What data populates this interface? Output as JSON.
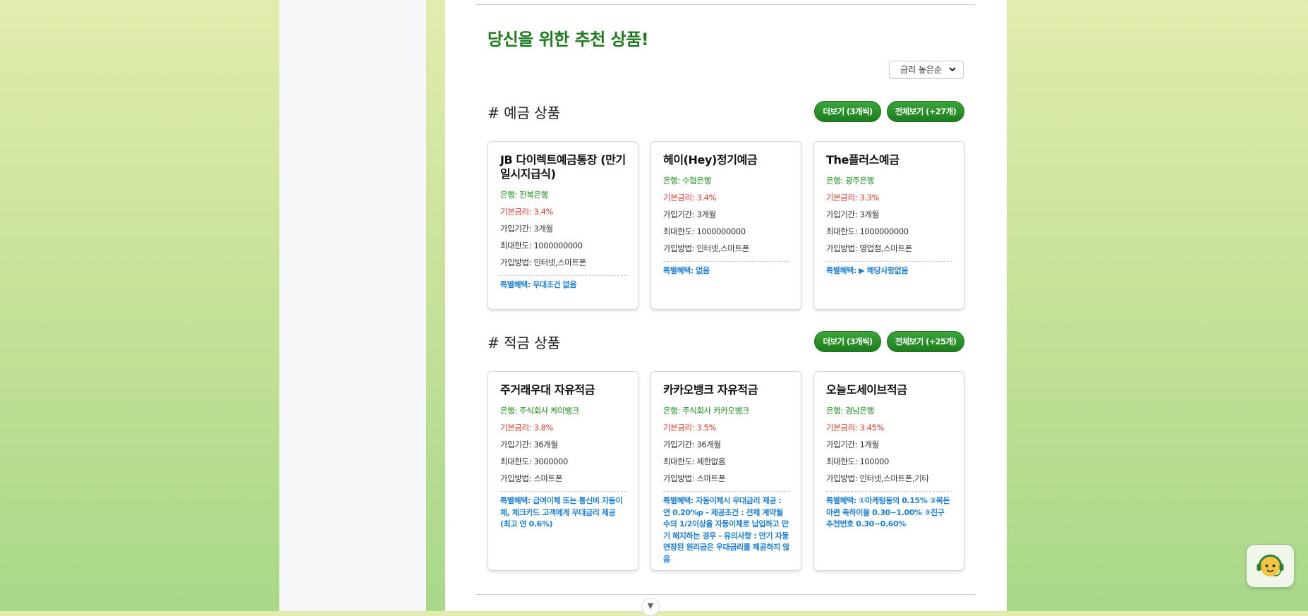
{
  "page": {
    "title": "당신을 위한 추천 상품!",
    "sort": {
      "selected": "금리 높은순"
    }
  },
  "colors": {
    "accent_green": "#1f7a1f",
    "bank_green": "#1a8a1a",
    "rate_red": "#e23b2e",
    "benefit_blue": "#1c7fd6"
  },
  "deposit": {
    "heading": "# 예금 상품",
    "more_label": "더보기 (3개씩)",
    "all_label": "전체보기 (+27개)",
    "cards": [
      {
        "name": "JB 다이렉트예금통장 (만기일시지급식)",
        "bank": "은행: 전북은행",
        "rate": "기본금리: 3.4%",
        "period": "가입기간: 3개월",
        "limit": "최대한도: 1000000000",
        "method": "가입방법: 인터넷,스마트폰",
        "benefit": "특별혜택: 우대조건 없음"
      },
      {
        "name": "헤이(Hey)정기예금",
        "bank": "은행: 수협은행",
        "rate": "기본금리: 3.4%",
        "period": "가입기간: 3개월",
        "limit": "최대한도: 1000000000",
        "method": "가입방법: 인터넷,스마트폰",
        "benefit": "특별혜택: 없음"
      },
      {
        "name": "The플러스예금",
        "bank": "은행: 광주은행",
        "rate": "기본금리: 3.3%",
        "period": "가입기간: 3개월",
        "limit": "최대한도: 1000000000",
        "method": "가입방법: 영업점,스마트폰",
        "benefit": "특별혜택: ▶ 해당사항없음"
      }
    ]
  },
  "savings": {
    "heading": "# 적금 상품",
    "more_label": "더보기 (3개씩)",
    "all_label": "전체보기 (+25개)",
    "cards": [
      {
        "name": "주거래우대 자유적금",
        "bank": "은행: 주식회사 케이뱅크",
        "rate": "기본금리: 3.8%",
        "period": "가입기간: 36개월",
        "limit": "최대한도: 3000000",
        "method": "가입방법: 스마트폰",
        "benefit": "특별혜택: 급여이체 또는 통신비 자동이체, 체크카드 고객에게 우대금리 제공 (최고 연 0.6%)"
      },
      {
        "name": "카카오뱅크 자유적금",
        "bank": "은행: 주식회사 카카오뱅크",
        "rate": "기본금리: 3.5%",
        "period": "가입기간: 36개월",
        "limit": "최대한도: 제한없음",
        "method": "가입방법: 스마트폰",
        "benefit": "특별혜택: 자동이체시 우대금리 제공 : 연 0.20%p - 제공조건 : 전체 계약월수의 1/2이상을 자동이체로 납입하고 만기 해지하는 경우 - 유의사항 : 만기 자동연장된 원리금은 우대금리를 제공하지 않음"
      },
      {
        "name": "오늘도세이브적금",
        "bank": "은행: 경남은행",
        "rate": "기본금리: 3.45%",
        "period": "가입기간: 1개월",
        "limit": "최대한도: 100000",
        "method": "가입방법: 인터넷,스마트폰,기타",
        "benefit": "특별혜택: ①마케팅동의 0.15% ②목돈마련 축하이율 0.30~1.00% ③친구 추천번호 0.30~0.60%"
      }
    ]
  },
  "icons": {
    "sort": "chevron-down-icon",
    "scroll": "scroll-down-icon",
    "chatbot": "chatbot-icon"
  }
}
